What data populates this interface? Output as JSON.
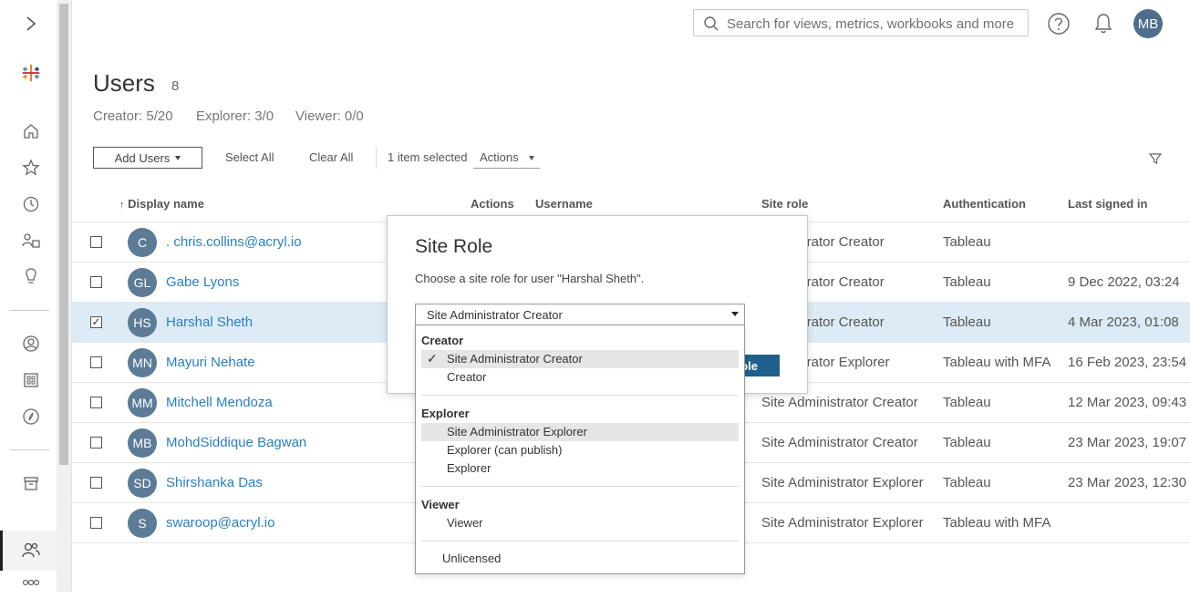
{
  "search": {
    "placeholder": "Search for views, metrics, workbooks and more"
  },
  "user_avatar": "MB",
  "page": {
    "title": "Users",
    "count": "8"
  },
  "licenses": {
    "creator": "Creator: 5/20",
    "explorer": "Explorer: 3/0",
    "viewer": "Viewer: 0/0"
  },
  "toolbar": {
    "add_users": "Add Users",
    "select_all": "Select All",
    "clear_all": "Clear All",
    "selected_count": "1 item selected",
    "actions": "Actions"
  },
  "table": {
    "columns": {
      "display_name": "Display name",
      "sort_indicator": "↑",
      "actions": "Actions",
      "username": "Username",
      "site_role": "Site role",
      "authentication": "Authentication",
      "last_signed_in": "Last signed in"
    },
    "rows": [
      {
        "initials": "C",
        "name": ". chris.collins@acryl.io",
        "role": "inistrator Creator",
        "auth": "Tableau",
        "last": "",
        "checked": false
      },
      {
        "initials": "GL",
        "name": "Gabe Lyons",
        "role": "inistrator Creator",
        "auth": "Tableau",
        "last": "9 Dec 2022, 03:24",
        "checked": false
      },
      {
        "initials": "HS",
        "name": "Harshal Sheth",
        "role": "inistrator Creator",
        "auth": "Tableau",
        "last": "4 Mar 2023, 01:08",
        "checked": true
      },
      {
        "initials": "MN",
        "name": "Mayuri Nehate",
        "role": "inistrator Explorer",
        "auth": "Tableau with MFA",
        "last": "16 Feb 2023, 23:54",
        "checked": false
      },
      {
        "initials": "MM",
        "name": "Mitchell Mendoza",
        "role": "Site Administrator Creator",
        "auth": "Tableau",
        "last": "12 Mar 2023, 09:43",
        "checked": false
      },
      {
        "initials": "MB",
        "name": "MohdSiddique Bagwan",
        "role": "Site Administrator Creator",
        "auth": "Tableau",
        "last": "23 Mar 2023, 19:07",
        "checked": false
      },
      {
        "initials": "SD",
        "name": "Shirshanka Das",
        "role": "Site Administrator Explorer",
        "auth": "Tableau",
        "last": "23 Mar 2023, 12:30",
        "checked": false
      },
      {
        "initials": "S",
        "name": "swaroop@acryl.io",
        "role": "Site Administrator Explorer",
        "auth": "Tableau with MFA",
        "last": "",
        "checked": false
      }
    ]
  },
  "modal": {
    "title": "Site Role",
    "description": "Choose a site role for user \"Harshal Sheth\".",
    "selected": "Site Administrator Creator",
    "button": "ole"
  },
  "dropdown": {
    "creator_group": "Creator",
    "creator_options": [
      "Site Administrator Creator",
      "Creator"
    ],
    "explorer_group": "Explorer",
    "explorer_options": [
      "Site Administrator Explorer",
      "Explorer (can publish)",
      "Explorer"
    ],
    "viewer_group": "Viewer",
    "viewer_options": [
      "Viewer"
    ],
    "unlicensed": "Unlicensed",
    "checkmark": "✓"
  },
  "colors": {
    "accent": "#1f5f8b",
    "link": "#2a7fc5",
    "avatar": "#5b7b96",
    "selected_row": "#dcebf5"
  }
}
